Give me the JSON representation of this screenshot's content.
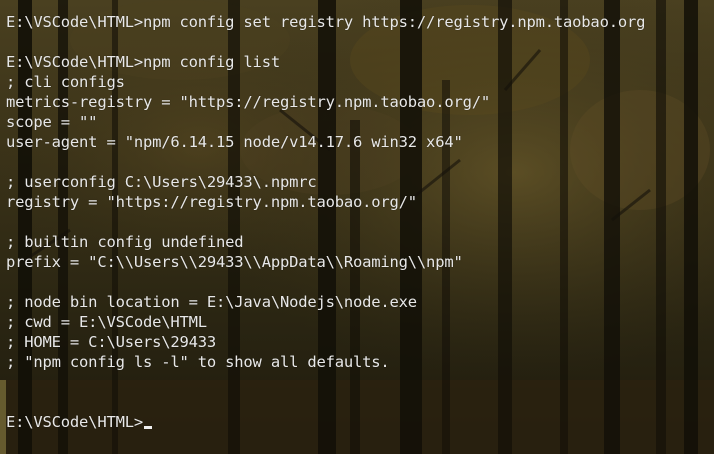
{
  "terminal": {
    "lines": [
      "E:\\VSCode\\HTML>npm config set registry https://registry.npm.taobao.org",
      "",
      "E:\\VSCode\\HTML>npm config list",
      "; cli configs",
      "metrics-registry = \"https://registry.npm.taobao.org/\"",
      "scope = \"\"",
      "user-agent = \"npm/6.14.15 node/v14.17.6 win32 x64\"",
      "",
      "; userconfig C:\\Users\\29433\\.npmrc",
      "registry = \"https://registry.npm.taobao.org/\"",
      "",
      "; builtin config undefined",
      "prefix = \"C:\\\\Users\\\\29433\\\\AppData\\\\Roaming\\\\npm\"",
      "",
      "; node bin location = E:\\Java\\Nodejs\\node.exe",
      "; cwd = E:\\VSCode\\HTML",
      "; HOME = C:\\Users\\29433",
      "; \"npm config ls -l\" to show all defaults.",
      "",
      "",
      "E:\\VSCode\\HTML>"
    ]
  },
  "colors": {
    "text": "#e8e8e8",
    "background": "#2a2416",
    "accent_trunk": "#0d0b06"
  }
}
